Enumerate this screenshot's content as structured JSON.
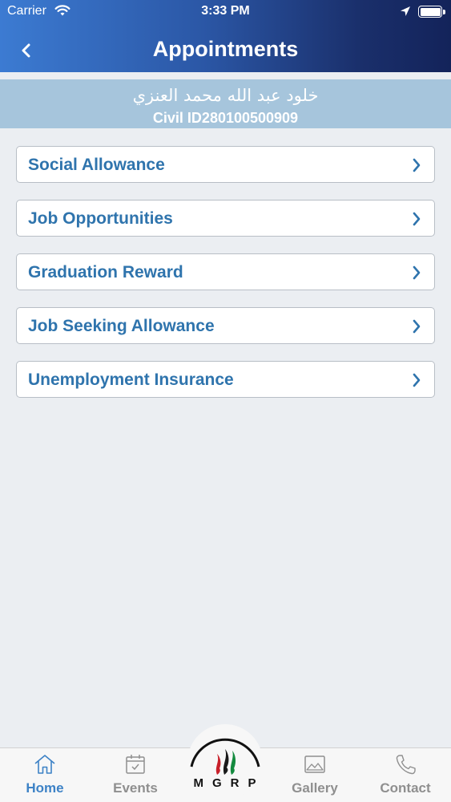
{
  "status_bar": {
    "carrier": "Carrier",
    "time": "3:33 PM"
  },
  "nav": {
    "title": "Appointments",
    "back_icon": "chevron-left-icon"
  },
  "user": {
    "name": "خلود عبد الله محمد العنزي",
    "civil_id": "Civil ID280100500909"
  },
  "menu": {
    "items": [
      {
        "label": "Social Allowance"
      },
      {
        "label": "Job Opportunities"
      },
      {
        "label": "Graduation Reward"
      },
      {
        "label": "Job Seeking Allowance"
      },
      {
        "label": "Unemployment Insurance"
      }
    ]
  },
  "tabs": [
    {
      "label": "Home",
      "icon": "home-icon",
      "active": true
    },
    {
      "label": "Events",
      "icon": "calendar-icon",
      "active": false
    },
    {
      "label": "Gallery",
      "icon": "picture-icon",
      "active": false
    },
    {
      "label": "Contact",
      "icon": "phone-icon",
      "active": false
    }
  ],
  "logo": {
    "letters": "MGRP"
  },
  "colors": {
    "header_gradient_start": "#3c7bd2",
    "header_gradient_end": "#13235a",
    "user_band": "#a6c5dc",
    "menu_text": "#2f74ad",
    "active_tab": "#3d82c6",
    "inactive_tab": "#8f8f8f",
    "background": "#ebeef2"
  }
}
